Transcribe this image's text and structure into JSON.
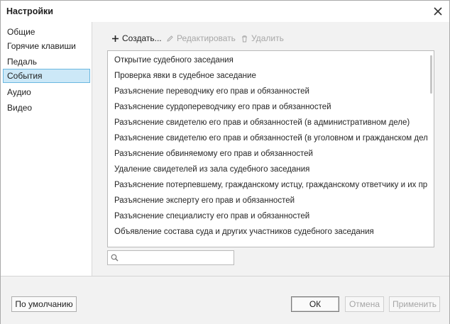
{
  "window": {
    "title": "Настройки"
  },
  "sidebar": {
    "items": [
      {
        "label": "Общие",
        "active": false
      },
      {
        "label": "Горячие клавиши",
        "active": false
      },
      {
        "label": "Педаль",
        "active": false
      },
      {
        "label": "События",
        "active": true
      },
      {
        "label": "Аудио",
        "active": false
      },
      {
        "label": "Видео",
        "active": false
      }
    ]
  },
  "toolbar": {
    "create_label": "Создать...",
    "edit_label": "Редактировать",
    "delete_label": "Удалить"
  },
  "events": {
    "items": [
      "Открытие судебного заседания",
      "Проверка явки в судебное заседание",
      "Разъяснение переводчику его прав и обязанностей",
      "Разъяснение сурдопереводчику его прав и обязанностей",
      "Разъяснение свидетелю его прав и обязанностей (в административном деле)",
      "Разъяснение свидетелю его прав и обязанностей (в уголовном и гражданском деле)",
      "Разъяснение обвиняемому его прав и обязанностей",
      "Удаление свидетелей из зала судебного заседания",
      "Разъяснение потерпевшему, гражданскому истцу, гражданскому ответчику и их предста",
      "Разъяснение эксперту его прав и обязанностей",
      "Разъяснение специалисту его прав и обязанностей",
      "Объявление состава суда и других участников судебного заседания"
    ]
  },
  "search": {
    "value": "",
    "placeholder": ""
  },
  "footer": {
    "defaults_label": "По умолчанию",
    "ok_label": "ОК",
    "cancel_label": "Отмена",
    "apply_label": "Применить"
  }
}
